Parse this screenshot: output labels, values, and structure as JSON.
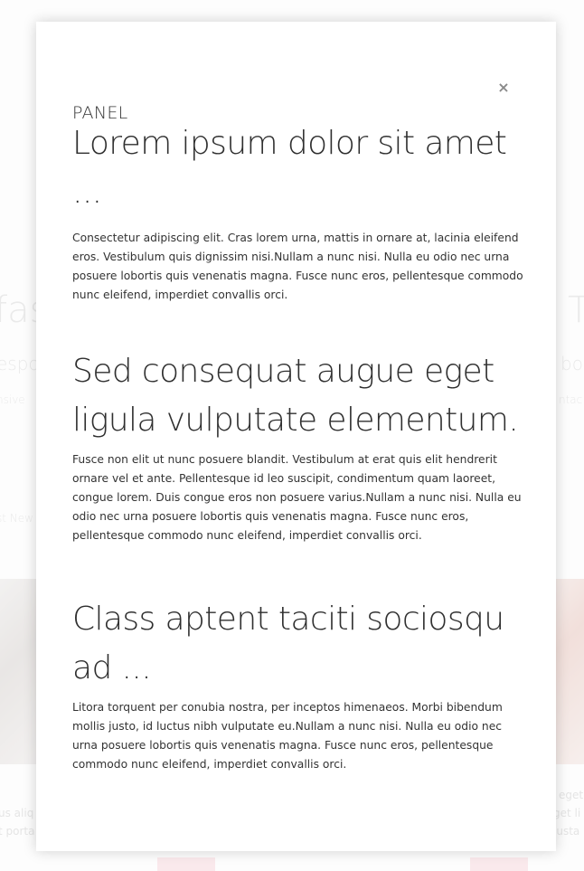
{
  "background": {
    "left_heading": "fas",
    "left_subheading": "espo",
    "left_small": "nsive",
    "left_link": "st New",
    "left_line1": "us aliq",
    "left_line2": "t porta",
    "right_heading": "T",
    "right_subheading": "bo:",
    "right_small": "ntac",
    "right_line1": "eget",
    "right_line2": "get li",
    "right_line3": "justa"
  },
  "panel": {
    "label": "PANEL",
    "close_icon": "×",
    "sections": [
      {
        "heading": "Lorem ipsum dolor sit amet ...",
        "body": "Consectetur adipiscing elit. Cras lorem urna, mattis in ornare at, lacinia eleifend eros. Vestibulum quis dignissim nisi.Nullam a nunc nisi. Nulla eu odio nec urna posuere lobortis quis venenatis magna. Fusce nunc eros, pellentesque commodo nunc eleifend, imperdiet convallis orci."
      },
      {
        "heading": "Sed consequat augue eget ligula vulputate elementum.",
        "body": "Fusce non elit ut nunc posuere blandit. Vestibulum at erat quis elit hendrerit ornare vel et ante. Pellentesque id leo suscipit, condimentum quam laoreet, congue lorem. Duis congue eros non posuere varius.Nullam a nunc nisi. Nulla eu odio nec urna posuere lobortis quis venenatis magna. Fusce nunc eros, pellentesque commodo nunc eleifend, imperdiet convallis orci."
      },
      {
        "heading": "Class aptent taciti sociosqu ad ...",
        "body": "Litora torquent per conubia nostra, per inceptos himenaeos. Morbi bibendum mollis justo, id luctus nibh vulputate eu.Nullam a nunc nisi. Nulla eu odio nec urna posuere lobortis quis venenatis magna. Fusce nunc eros, pellentesque commodo nunc eleifend, imperdiet convallis orci."
      }
    ]
  },
  "colors": {
    "panel_background": "#ffffff",
    "heading_text": "#2f2f2f",
    "body_text": "#333333",
    "close_icon": "#8a8a8a",
    "background_accent": "#f6d8dc"
  }
}
